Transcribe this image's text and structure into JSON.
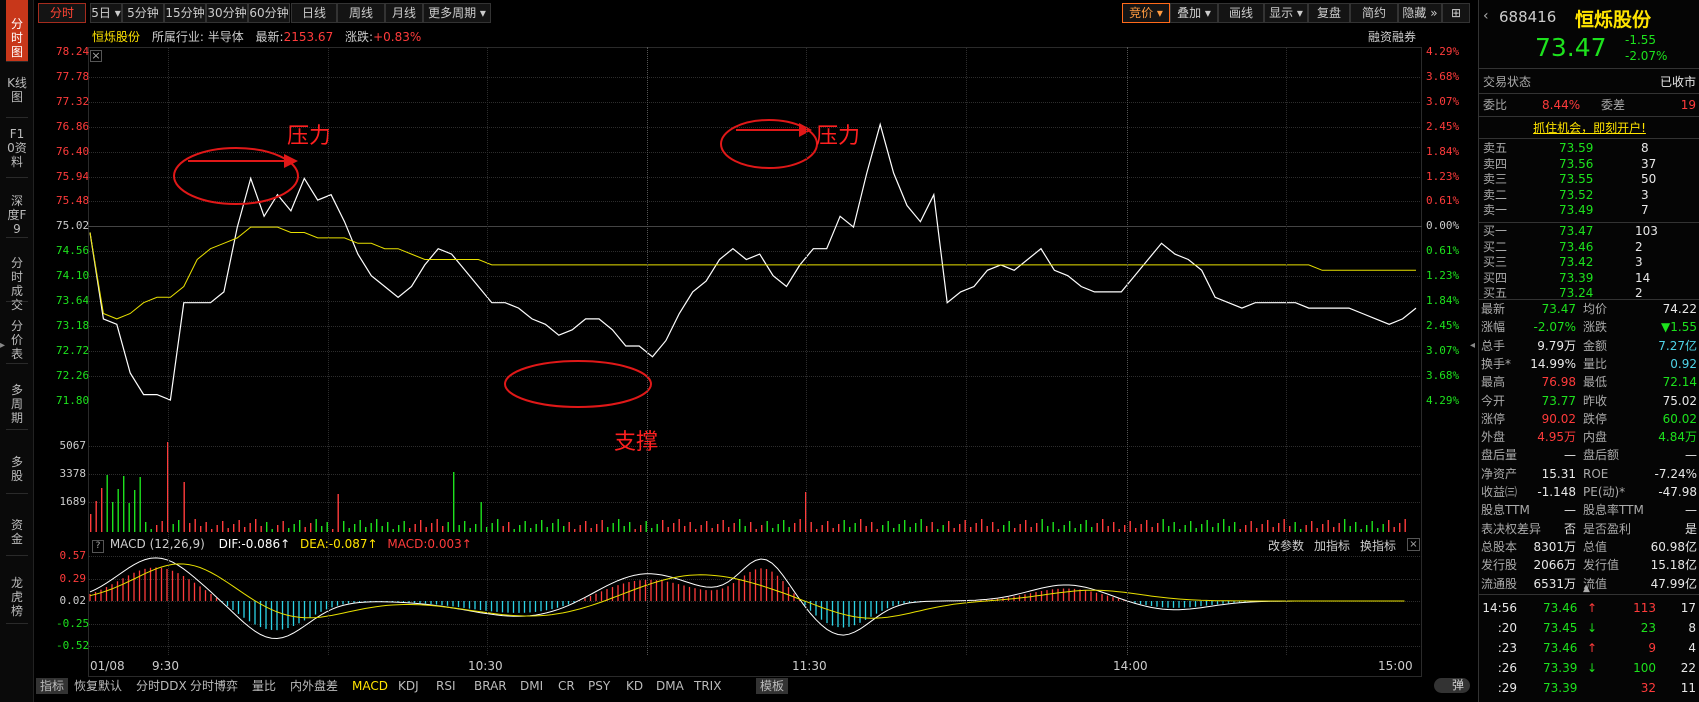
{
  "left_tabs": [
    "分时图",
    "K线图",
    "F10资料",
    "深度F9",
    "分时成交",
    "分价表",
    "多周期",
    "多股",
    "资金",
    "龙虎榜"
  ],
  "toolbar": {
    "left": [
      "分时",
      "5日",
      "5分钟",
      "15分钟",
      "30分钟",
      "60分钟",
      "日线",
      "周线",
      "月线",
      "更多周期"
    ],
    "right": [
      "竞价",
      "叠加",
      "画线",
      "显示",
      "复盘",
      "简约",
      "隐藏",
      "⊞"
    ]
  },
  "info": {
    "name": "恒烁股份",
    "industry": "所属行业: 半导体",
    "latest_label": "最新:",
    "latest_value": "2153.67",
    "change_label": "涨跌:",
    "change_value": "+0.83%",
    "margin": "融资融券"
  },
  "price_axis": {
    "left": [
      "78.24",
      "77.78",
      "77.32",
      "76.86",
      "76.40",
      "75.94",
      "75.48",
      "75.02",
      "74.56",
      "74.10",
      "73.64",
      "73.18",
      "72.72",
      "72.26",
      "71.80"
    ],
    "right": [
      "4.29%",
      "3.68%",
      "3.07%",
      "2.45%",
      "1.84%",
      "1.23%",
      "0.61%",
      "0.00%",
      "0.61%",
      "1.23%",
      "1.84%",
      "2.45%",
      "3.07%",
      "3.68%",
      "4.29%"
    ]
  },
  "volume_axis": [
    "5067",
    "3378",
    "1689"
  ],
  "macd": {
    "title": "MACD (12,26,9)",
    "dif": "DIF:-0.086↑",
    "dea": "DEA:-0.087↑",
    "macd": "MACD:0.003↑",
    "axis": [
      "0.57",
      "0.29",
      "0.02",
      "-0.25",
      "-0.52"
    ],
    "actions": [
      "改参数",
      "加指标",
      "换指标"
    ]
  },
  "annotations": {
    "pressure1": "压力",
    "pressure2": "压力",
    "support": "支撑"
  },
  "time_axis": [
    "01/08",
    "9:30",
    "10:30",
    "11:30",
    "14:00",
    "15:00"
  ],
  "bottom_tabs": [
    "指标",
    "恢复默认",
    "分时DDX",
    "分时博弈",
    "量比",
    "内外盘差",
    "MACD",
    "KDJ",
    "RSI",
    "BRAR",
    "DMI",
    "CR",
    "PSY",
    "KD",
    "DMA",
    "TRIX",
    "模板"
  ],
  "bottom_right": "弹",
  "chart_data": {
    "type": "line",
    "series": [
      {
        "values": [
          74.9,
          73.3,
          73.2,
          72.3,
          71.9,
          71.9,
          71.8,
          73.6,
          73.6,
          73.6,
          73.8,
          75.0,
          75.9,
          75.2,
          75.6,
          75.3,
          75.9,
          75.5,
          75.6,
          75.1,
          74.5,
          74.1,
          73.9,
          73.7,
          73.9,
          74.3,
          74.6,
          74.5,
          74.2,
          73.9,
          73.6,
          73.6,
          73.5,
          73.3,
          73.2,
          73.0,
          73.1,
          73.3,
          73.3,
          73.1,
          72.8,
          72.8,
          72.6,
          72.9,
          73.4,
          73.8,
          74.0,
          74.4,
          74.6,
          74.4,
          74.5,
          74.1,
          73.9,
          74.3,
          74.6,
          74.6,
          75.2,
          75.0,
          76.0,
          76.9,
          76.0,
          75.4,
          75.1,
          75.6,
          73.6,
          73.8,
          73.9,
          74.2,
          74.3,
          74.2,
          74.4,
          74.6,
          74.2,
          74.1,
          73.9,
          73.8,
          73.8,
          73.8,
          74.1,
          74.4,
          74.7,
          74.5,
          74.4,
          74.2,
          73.7,
          73.6,
          73.5,
          73.6,
          73.6,
          73.6,
          73.6,
          73.5,
          73.5,
          73.5,
          73.5,
          73.4,
          73.3,
          73.2,
          73.3,
          73.5
        ],
        "color": "#ffffff"
      },
      {
        "values": [
          74.9,
          73.4,
          73.3,
          73.4,
          73.6,
          73.7,
          73.7,
          73.9,
          74.4,
          74.6,
          74.7,
          74.8,
          75.0,
          75.0,
          75.0,
          74.9,
          74.9,
          74.8,
          74.8,
          74.8,
          74.7,
          74.7,
          74.6,
          74.6,
          74.5,
          74.4,
          74.4,
          74.4,
          74.4,
          74.4,
          74.3,
          74.3,
          74.3,
          74.3,
          74.3,
          74.3,
          74.3,
          74.3,
          74.3,
          74.3,
          74.3,
          74.3,
          74.3,
          74.3,
          74.3,
          74.3,
          74.3,
          74.3,
          74.3,
          74.3,
          74.3,
          74.3,
          74.3,
          74.3,
          74.3,
          74.3,
          74.3,
          74.3,
          74.3,
          74.3,
          74.3,
          74.3,
          74.3,
          74.3,
          74.3,
          74.3,
          74.3,
          74.3,
          74.3,
          74.3,
          74.3,
          74.3,
          74.3,
          74.3,
          74.3,
          74.3,
          74.3,
          74.3,
          74.3,
          74.3,
          74.3,
          74.3,
          74.3,
          74.3,
          74.3,
          74.3,
          74.3,
          74.3,
          74.3,
          74.3,
          74.3,
          74.3,
          74.2,
          74.2,
          74.2,
          74.2,
          74.2,
          74.2,
          74.2,
          74.2
        ],
        "color": "#e8e000"
      }
    ],
    "ylim": [
      71.8,
      78.24
    ],
    "prev_close": 75.02
  },
  "quote": {
    "code": "688416",
    "name": "恒烁股份",
    "price": "73.47",
    "change": "-1.55",
    "change_pct": "-2.07%",
    "status_label": "交易状态",
    "status_value": "已收市",
    "wb_label": "委比",
    "wb_value": "8.44%",
    "wc_label": "委差",
    "wc_value": "19",
    "promo": "抓住机会，即刻开户!",
    "sells": [
      {
        "label": "卖五",
        "price": "73.59",
        "vol": "8"
      },
      {
        "label": "卖四",
        "price": "73.56",
        "vol": "37"
      },
      {
        "label": "卖三",
        "price": "73.55",
        "vol": "50"
      },
      {
        "label": "卖二",
        "price": "73.52",
        "vol": "3"
      },
      {
        "label": "卖一",
        "price": "73.49",
        "vol": "7"
      }
    ],
    "buys": [
      {
        "label": "买一",
        "price": "73.47",
        "vol": "103"
      },
      {
        "label": "买二",
        "price": "73.46",
        "vol": "2"
      },
      {
        "label": "买三",
        "price": "73.42",
        "vol": "3"
      },
      {
        "label": "买四",
        "price": "73.39",
        "vol": "14"
      },
      {
        "label": "买五",
        "price": "73.24",
        "vol": "2"
      }
    ],
    "stats": [
      {
        "l1": "最新",
        "v1": "73.47",
        "c1": "green",
        "l2": "均价",
        "v2": "74.22",
        "c2": "white"
      },
      {
        "l1": "涨幅",
        "v1": "-2.07%",
        "c1": "green",
        "l2": "涨跌",
        "v2": "▼1.55",
        "c2": "green"
      },
      {
        "l1": "总手",
        "v1": "9.79万",
        "c1": "white",
        "l2": "金额",
        "v2": "7.27亿",
        "c2": "cyan"
      },
      {
        "l1": "换手*",
        "v1": "14.99%",
        "c1": "white",
        "l2": "量比",
        "v2": "0.92",
        "c2": "cyan"
      },
      {
        "l1": "最高",
        "v1": "76.98",
        "c1": "red",
        "l2": "最低",
        "v2": "72.14",
        "c2": "green"
      },
      {
        "l1": "今开",
        "v1": "73.77",
        "c1": "green",
        "l2": "昨收",
        "v2": "75.02",
        "c2": "white"
      },
      {
        "l1": "涨停",
        "v1": "90.02",
        "c1": "red",
        "l2": "跌停",
        "v2": "60.02",
        "c2": "green"
      },
      {
        "l1": "外盘",
        "v1": "4.95万",
        "c1": "red",
        "l2": "内盘",
        "v2": "4.84万",
        "c2": "green"
      },
      {
        "l1": "盘后量",
        "v1": "—",
        "c1": "white",
        "l2": "盘后额",
        "v2": "—",
        "c2": "white"
      },
      {
        "l1": "净资产",
        "v1": "15.31",
        "c1": "white",
        "l2": "ROE",
        "v2": "-7.24%",
        "c2": "white"
      },
      {
        "l1": "收益㈢",
        "v1": "-1.148",
        "c1": "white",
        "l2": "PE(动)*",
        "v2": "-47.98",
        "c2": "white"
      },
      {
        "l1": "股息TTM",
        "v1": "—",
        "c1": "white",
        "l2": "股息率TTM",
        "v2": "—",
        "c2": "white"
      },
      {
        "l1": "表决权差异",
        "v1": "否",
        "c1": "white",
        "l2": "是否盈利",
        "v2": "是",
        "c2": "white"
      },
      {
        "l1": "总股本",
        "v1": "8301万",
        "c1": "white",
        "l2": "总值",
        "v2": "60.98亿",
        "c2": "white"
      },
      {
        "l1": "发行股",
        "v1": "2066万",
        "c1": "white",
        "l2": "发行值",
        "v2": "15.18亿",
        "c2": "white"
      },
      {
        "l1": "流通股",
        "v1": "6531万",
        "c1": "white",
        "l2": "流值",
        "v2": "47.99亿",
        "c2": "white"
      }
    ],
    "ticks": [
      {
        "time": "14:56",
        "price": "73.46",
        "arrow": "↑",
        "pc": "green",
        "ac": "red",
        "vol": "113",
        "vc": "red",
        "n": "17"
      },
      {
        "time": ":20",
        "price": "73.45",
        "arrow": "↓",
        "pc": "green",
        "ac": "green",
        "vol": "23",
        "vc": "green",
        "n": "8"
      },
      {
        "time": ":23",
        "price": "73.46",
        "arrow": "↑",
        "pc": "green",
        "ac": "red",
        "vol": "9",
        "vc": "red",
        "n": "4"
      },
      {
        "time": ":26",
        "price": "73.39",
        "arrow": "↓",
        "pc": "green",
        "ac": "green",
        "vol": "100",
        "vc": "green",
        "n": "22"
      },
      {
        "time": ":29",
        "price": "73.39",
        "arrow": "",
        "pc": "green",
        "ac": "red",
        "vol": "32",
        "vc": "red",
        "n": "11"
      }
    ]
  }
}
